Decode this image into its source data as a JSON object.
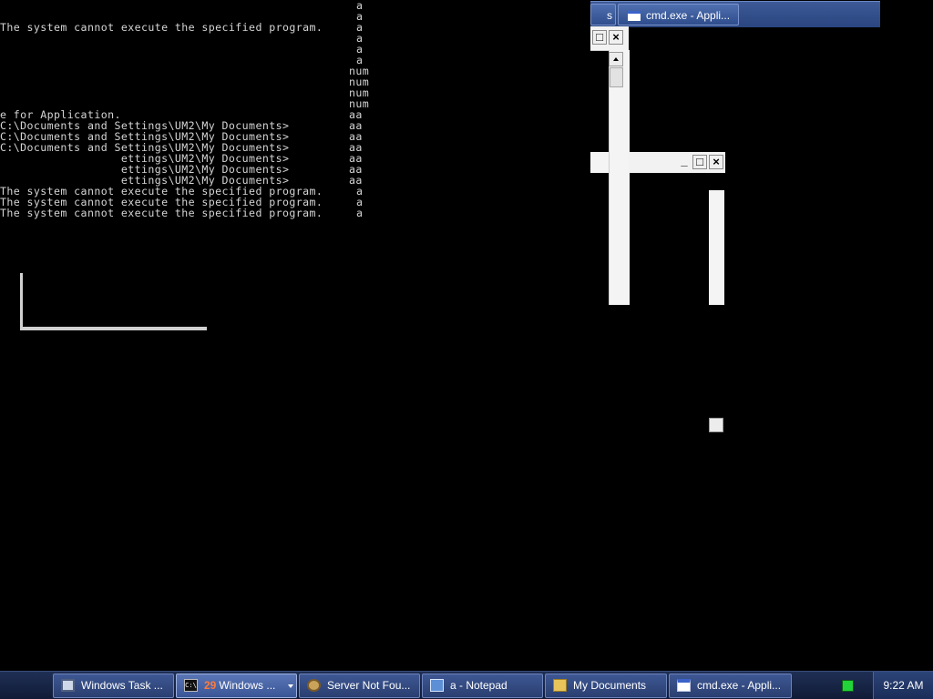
{
  "console": {
    "left_lines": [
      "",
      "",
      "The system cannot execute the specified program.",
      "",
      "",
      "",
      "",
      "",
      "",
      "",
      "e for Application.",
      "C:\\Documents and Settings\\UM2\\My Documents>",
      "C:\\Documents and Settings\\UM2\\My Documents>",
      "C:\\Documents and Settings\\UM2\\My Documents>",
      "                  ettings\\UM2\\My Documents>",
      "                  ettings\\UM2\\My Documents>",
      "                  ettings\\UM2\\My Documents>",
      "The system cannot execute the specified program.",
      "The system cannot execute the specified program.",
      "The system cannot execute the specified program."
    ],
    "right_column": [
      "a",
      "a",
      "a",
      "a",
      "a",
      "a",
      "num",
      "num",
      "num",
      "num",
      "aa",
      "aa",
      "aa",
      "aa",
      "aa",
      "aa",
      "aa",
      "a",
      "a",
      "a"
    ]
  },
  "top_window_button": {
    "partial_label": "s",
    "label": "cmd.exe - Appli...",
    "icon": "window-icon"
  },
  "ghost_windows": {
    "caption_maximize": "□",
    "caption_close": "×",
    "caption_minimize": "_"
  },
  "taskbar": {
    "buttons": [
      {
        "label": "Windows Task ...",
        "icon": "task-manager-icon",
        "active": false
      },
      {
        "count": "29",
        "label": "Windows ...",
        "icon": "command-prompt-icon",
        "active": true,
        "grouped": true
      },
      {
        "label": "Server Not Fou...",
        "icon": "internet-explorer-icon",
        "active": false
      },
      {
        "label": "a - Notepad",
        "icon": "notepad-icon",
        "active": false
      },
      {
        "label": "My Documents",
        "icon": "folder-icon",
        "active": false
      },
      {
        "label": "cmd.exe - Appli...",
        "icon": "window-icon",
        "active": false
      }
    ],
    "tray_icon": "network-status-icon",
    "clock": "9:22 AM"
  }
}
